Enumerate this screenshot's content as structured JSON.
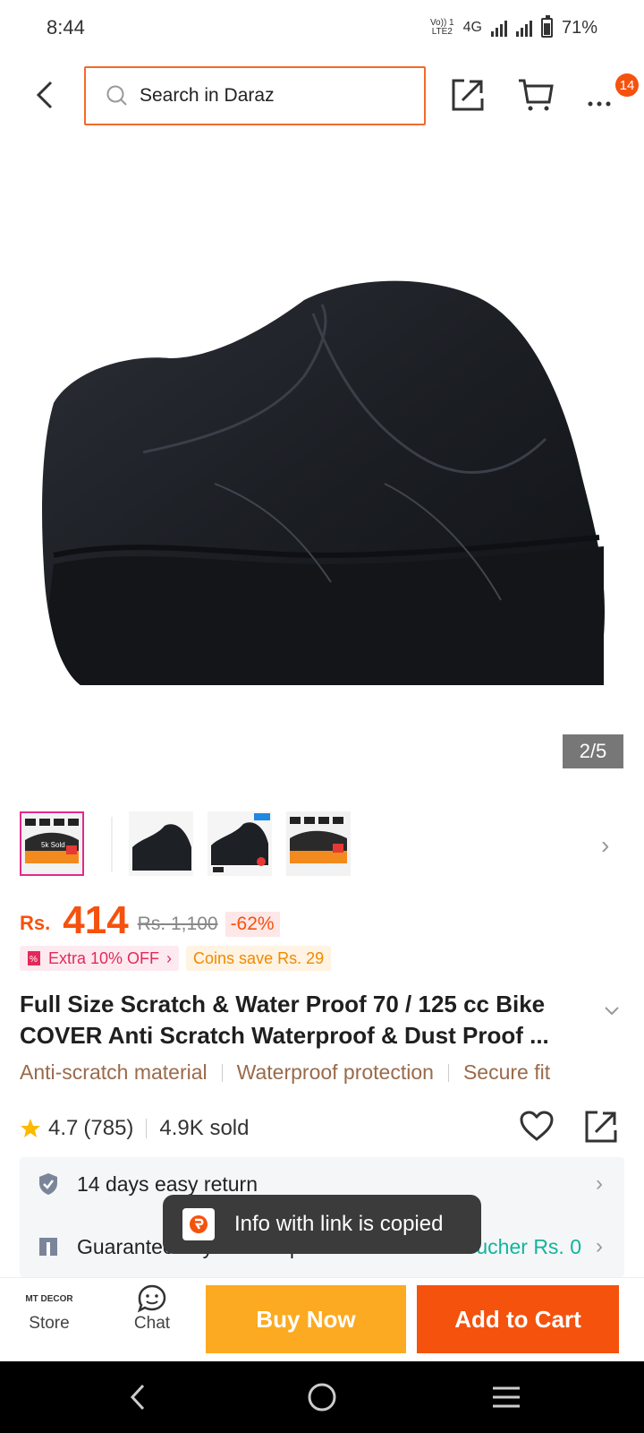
{
  "status": {
    "time": "8:44",
    "network_top": "Vo)) 1",
    "network_bottom": "LTE2",
    "network_type": "4G",
    "battery": "71%"
  },
  "header": {
    "search_placeholder": "Search in Daraz",
    "cart_badge": "14",
    "icons": [
      "back-icon",
      "search-icon",
      "share-icon",
      "cart-icon",
      "more-icon"
    ]
  },
  "gallery": {
    "counter": "2/5",
    "thumb_sold_label": "5k Sold",
    "thumb_count": 4
  },
  "price": {
    "currency": "Rs.",
    "current": "414",
    "original": "Rs. 1,100",
    "discount": "-62%"
  },
  "promos": {
    "extra_off": "Extra 10% OFF",
    "coins": "Coins save Rs. 29"
  },
  "product": {
    "title": "Full Size Scratch & Water Proof 70 / 125 cc Bike COVER Anti Scratch Waterproof & Dust Proof ...",
    "features": [
      "Anti-scratch material",
      "Waterproof protection",
      "Secure fit"
    ],
    "rating": "4.7",
    "reviews": "(785)",
    "sold": "4.9K sold"
  },
  "services": {
    "return": "14 days easy return",
    "delivery": "Guaranteed by 24-27 Apr",
    "voucher": "With Voucher Rs. 0"
  },
  "toast": {
    "message": "Info with link is copied"
  },
  "bottom_bar": {
    "store_logo": "MT DECOR",
    "store": "Store",
    "chat": "Chat",
    "buy_now": "Buy Now",
    "add_to_cart": "Add to Cart"
  },
  "colors": {
    "accent": "#f5520e",
    "buy_now": "#fcaa21",
    "voucher": "#11b59b",
    "feature_text": "#9a6a4a"
  }
}
